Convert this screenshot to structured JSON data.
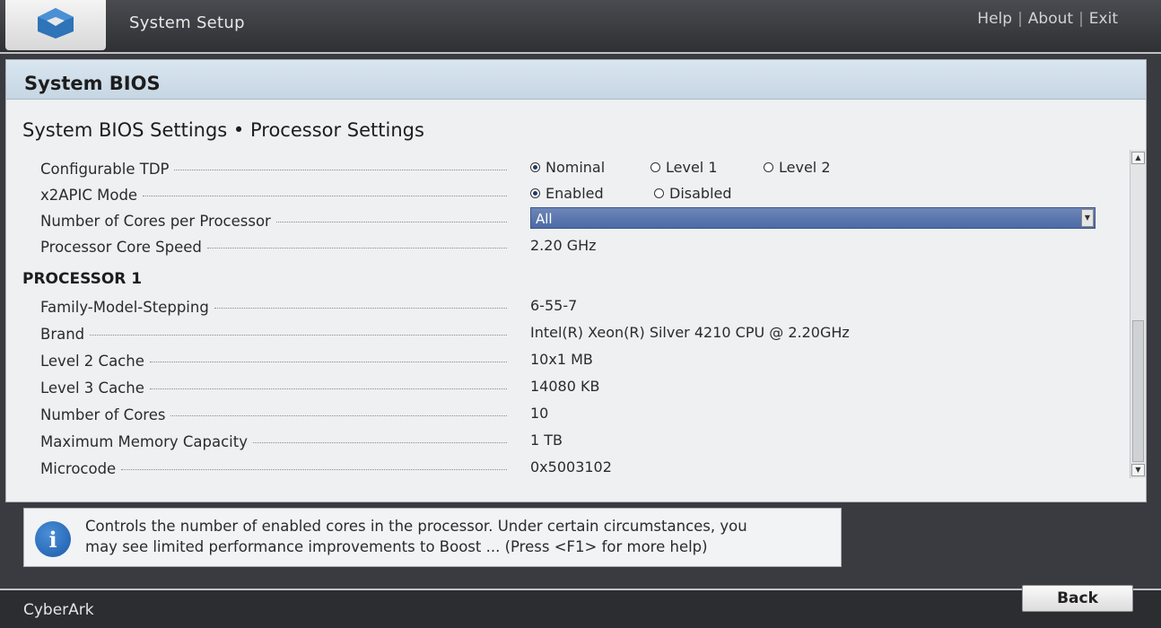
{
  "header": {
    "app_title": "System Setup",
    "links": [
      "Help",
      "About",
      "Exit"
    ],
    "separator": "|",
    "logo_icon": "cube-logo-icon"
  },
  "panel": {
    "title": "System BIOS",
    "page_title": "System BIOS Settings • Processor Settings"
  },
  "settings": [
    {
      "label": "Configurable TDP",
      "type": "radio",
      "options": [
        "Nominal",
        "Level 1",
        "Level 2"
      ],
      "selected": "Nominal"
    },
    {
      "label": "x2APIC Mode",
      "type": "radio",
      "options": [
        "Enabled",
        "Disabled"
      ],
      "selected": "Enabled"
    },
    {
      "label": "Number of Cores per Processor",
      "type": "select",
      "value": "All"
    },
    {
      "label": "Processor Core Speed",
      "type": "text",
      "value": "2.20 GHz"
    }
  ],
  "processor": {
    "heading": "PROCESSOR 1",
    "rows": [
      {
        "label": "Family-Model-Stepping",
        "value": "6-55-7"
      },
      {
        "label": "Brand",
        "value": "Intel(R) Xeon(R) Silver 4210 CPU @ 2.20GHz"
      },
      {
        "label": "Level 2 Cache",
        "value": "10x1 MB"
      },
      {
        "label": "Level 3 Cache",
        "value": "14080 KB"
      },
      {
        "label": "Number of Cores",
        "value": "10"
      },
      {
        "label": "Maximum Memory Capacity",
        "value": "1 TB"
      },
      {
        "label": "Microcode",
        "value": "0x5003102"
      }
    ]
  },
  "help": {
    "icon": "info-icon",
    "line1": "Controls the number of enabled cores in the processor. Under certain circumstances, you",
    "line2": "may see limited performance improvements to Boost ... (Press <F1> for more help)"
  },
  "footer": {
    "name": "CyberArk",
    "back_label": "Back"
  },
  "colors": {
    "header_bg": "#2f3034",
    "panel_header": "#c6d6e3",
    "select_bg": "#4c6aa6"
  }
}
